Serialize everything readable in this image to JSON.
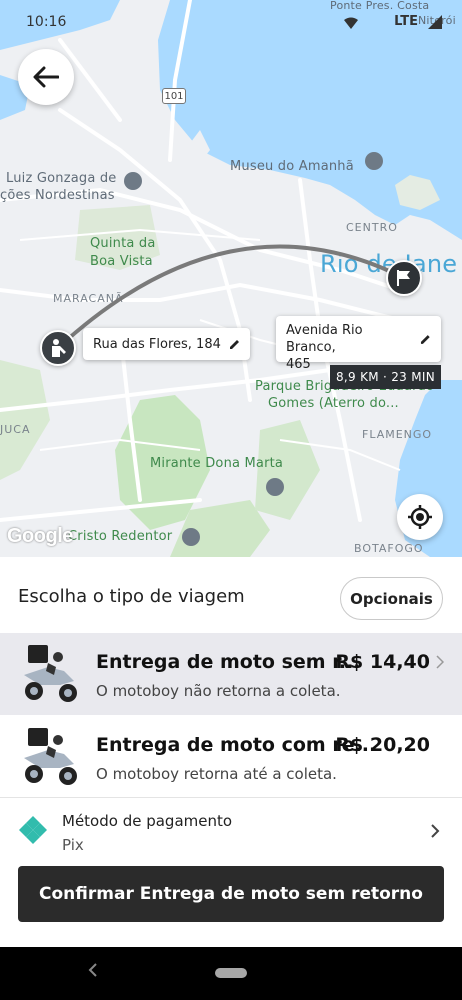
{
  "status_bar": {
    "time": "10:16",
    "network": "LTE"
  },
  "map": {
    "labels": {
      "poste_pres": "Ponte Pres. Costa",
      "niteroi": "Niterói",
      "museu": "Museu do Amanhã",
      "luiz_gonzaga": "Luiz Gonzaga de",
      "nordestinas": "ções Nordestinas",
      "quinta": "Quinta da",
      "boa_vista": "Boa Vista",
      "maracana": "MARACANÃ",
      "centro": "CENTRO",
      "rio": "Rio de Jane",
      "parque": "Parque Brigadeiro Eduardo",
      "gomes": "Gomes (Aterro do...",
      "juca": "JUCA",
      "flamengo": "FLAMENGO",
      "mirante": "Mirante Dona Marta",
      "cristo": "Cristo Redentor",
      "botafogo": "BOTAFOGO",
      "route_101": "101"
    },
    "origin_address": "Rua das Flores, 184",
    "destination_address_line1": "Avenida Rio Branco,",
    "destination_address_line2": "465",
    "distance_time": "8,9 KM · 23 MIN",
    "google_logo": "Google"
  },
  "sheet": {
    "title": "Escolha o tipo de viagem",
    "options_button": "Opcionais",
    "rides": [
      {
        "name": "Entrega de moto sem r...",
        "price": "R$ 14,40",
        "description": "O motoboy não retorna a coleta.",
        "selected": true
      },
      {
        "name": "Entrega de moto com re...",
        "price": "R$ 20,20",
        "description": "O motoboy retorna  até a coleta.",
        "selected": false
      }
    ],
    "payment": {
      "label": "Método de pagamento",
      "value": "Pix"
    },
    "confirm_button": "Confirmar Entrega de moto sem retorno"
  },
  "colors": {
    "water": "#aadaff",
    "park": "#c8e6c0",
    "route": "#7a7a7a",
    "dark": "#2b2b2b",
    "pix": "#32bcad"
  }
}
